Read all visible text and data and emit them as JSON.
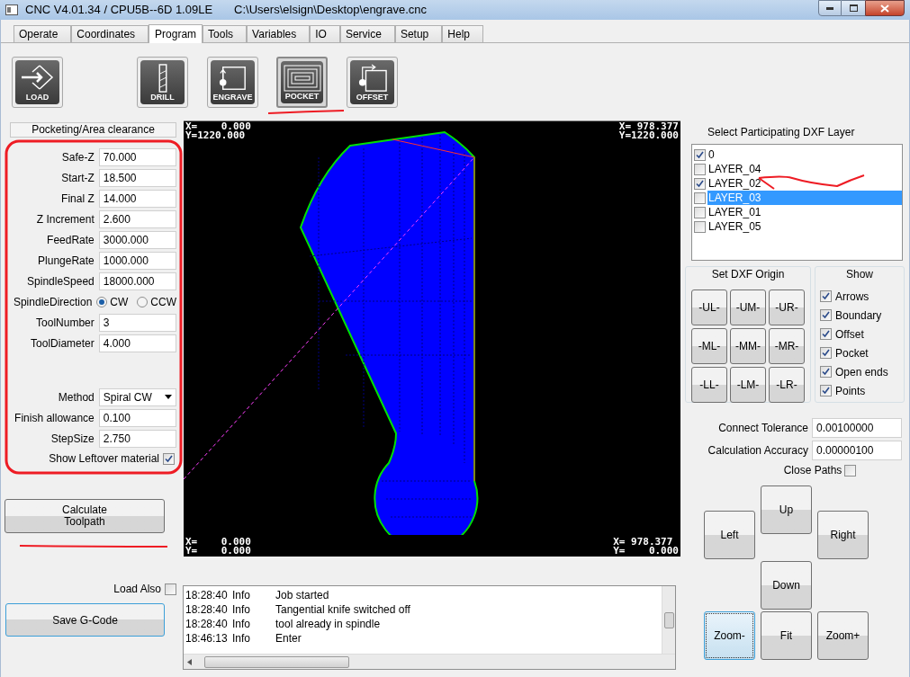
{
  "window": {
    "title": "CNC V4.01.34 / CPU5B--6D 1.09LE",
    "path": "C:\\Users\\elsign\\Desktop\\engrave.cnc"
  },
  "tabs": [
    {
      "label": "Operate",
      "selected": false
    },
    {
      "label": "Coordinates",
      "selected": false
    },
    {
      "label": "Program",
      "selected": true
    },
    {
      "label": "Tools",
      "selected": false
    },
    {
      "label": "Variables",
      "selected": false
    },
    {
      "label": "IO",
      "selected": false
    },
    {
      "label": "Service",
      "selected": false
    },
    {
      "label": "Setup",
      "selected": false
    },
    {
      "label": "Help",
      "selected": false
    }
  ],
  "toolbar": [
    {
      "label": "LOAD",
      "kind": "load",
      "selected": false
    },
    {
      "label": "DRILL",
      "kind": "drill",
      "selected": false
    },
    {
      "label": "ENGRAVE",
      "kind": "engrave",
      "selected": false
    },
    {
      "label": "POCKET",
      "kind": "pocket",
      "selected": true
    },
    {
      "label": "OFFSET",
      "kind": "offset",
      "selected": false
    }
  ],
  "panel": {
    "title": "Pocketing/Area clearance",
    "fields": [
      {
        "label": "Safe-Z",
        "kind": "input",
        "value": "70.000"
      },
      {
        "label": "Start-Z",
        "kind": "input",
        "value": "18.500"
      },
      {
        "label": "Final Z",
        "kind": "input",
        "value": "14.000"
      },
      {
        "label": "Z Increment",
        "kind": "input",
        "value": "2.600"
      },
      {
        "label": "FeedRate",
        "kind": "input",
        "value": "3000.000"
      },
      {
        "label": "PlungeRate",
        "kind": "input",
        "value": "1000.000"
      },
      {
        "label": "SpindleSpeed",
        "kind": "input",
        "value": "18000.000"
      },
      {
        "label": "SpindleDirection",
        "kind": "radio",
        "options": [
          {
            "label": "CW",
            "selected": true
          },
          {
            "label": "CCW",
            "selected": false
          }
        ]
      },
      {
        "label": "ToolNumber",
        "kind": "input",
        "value": "3"
      },
      {
        "label": "ToolDiameter",
        "kind": "input",
        "value": "4.000"
      }
    ],
    "method_fields": [
      {
        "label": "Method",
        "kind": "select",
        "value": "Spiral CW"
      },
      {
        "label": "Finish allowance",
        "kind": "input",
        "value": "0.100"
      },
      {
        "label": "StepSize",
        "kind": "input",
        "value": "2.750"
      }
    ],
    "leftover": {
      "label": "Show Leftover material",
      "checked": true
    }
  },
  "calculate_button": "Calculate\nToolpath",
  "load_also": {
    "label": "Load Also",
    "checked": false
  },
  "save_button": "Save G-Code",
  "canvas": {
    "top_left": [
      "X=    0.000",
      "Y=1220.000"
    ],
    "top_right": [
      "X= 978.377",
      "Y=1220.000"
    ],
    "bottom_left": [
      "X=    0.000",
      "Y=    0.000"
    ],
    "bottom_right": [
      "X= 978.377",
      "Y=    0.000"
    ]
  },
  "log": [
    {
      "time": "18:28:40",
      "level": "Info",
      "message": "Job started"
    },
    {
      "time": "18:28:40",
      "level": "Info",
      "message": "Tangential knife switched off"
    },
    {
      "time": "18:28:40",
      "level": "Info",
      "message": "tool already in spindle"
    },
    {
      "time": "18:46:13",
      "level": "Info",
      "message": "Enter"
    }
  ],
  "layers": {
    "title": "Select Participating DXF Layer",
    "items": [
      {
        "label": "0",
        "checked": true,
        "selected": false
      },
      {
        "label": "LAYER_04",
        "checked": false,
        "selected": false
      },
      {
        "label": "LAYER_02",
        "checked": true,
        "selected": false
      },
      {
        "label": "LAYER_03",
        "checked": false,
        "selected": true
      },
      {
        "label": "LAYER_01",
        "checked": false,
        "selected": false
      },
      {
        "label": "LAYER_05",
        "checked": false,
        "selected": false
      }
    ]
  },
  "origin": {
    "title": "Set DXF Origin",
    "buttons": [
      "-UL-",
      "-UM-",
      "-UR-",
      "-ML-",
      "-MM-",
      "-MR-",
      "-LL-",
      "-LM-",
      "-LR-"
    ]
  },
  "show": {
    "title": "Show",
    "items": [
      {
        "label": "Arrows",
        "checked": true
      },
      {
        "label": "Boundary",
        "checked": true
      },
      {
        "label": "Offset",
        "checked": true
      },
      {
        "label": "Pocket",
        "checked": true
      },
      {
        "label": "Open ends",
        "checked": true
      },
      {
        "label": "Points",
        "checked": true
      }
    ]
  },
  "settings": [
    {
      "label": "Connect Tolerance",
      "value": "0.00100000"
    },
    {
      "label": "Calculation Accuracy",
      "value": "0.00000100"
    }
  ],
  "close_paths": {
    "label": "Close Paths",
    "checked": false
  },
  "nav": [
    {
      "label": "Up",
      "focused": false
    },
    {
      "label": "Left",
      "focused": false
    },
    {
      "label": "Right",
      "focused": false
    },
    {
      "label": "Down",
      "focused": false
    },
    {
      "label": "Zoom-",
      "focused": true
    },
    {
      "label": "Fit",
      "focused": false
    },
    {
      "label": "Zoom+",
      "focused": false
    }
  ]
}
